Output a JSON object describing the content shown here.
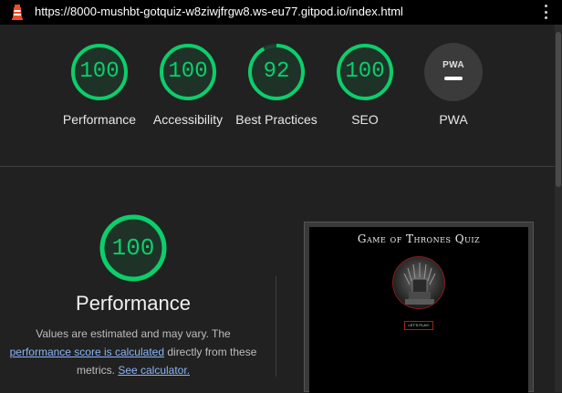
{
  "browser": {
    "url": "https://8000-mushbt-gotquiz-w8ziwjfrgw8.ws-eu77.gitpod.io/index.html"
  },
  "summary_gauges": [
    {
      "score": "100",
      "label": "Performance",
      "fraction": 1.0,
      "color": "#0cce6b"
    },
    {
      "score": "100",
      "label": "Accessibility",
      "fraction": 1.0,
      "color": "#0cce6b"
    },
    {
      "score": "92",
      "label": "Best Practices",
      "fraction": 0.92,
      "color": "#0cce6b"
    },
    {
      "score": "100",
      "label": "SEO",
      "fraction": 1.0,
      "color": "#0cce6b"
    },
    {
      "badge": "PWA",
      "label": "PWA"
    }
  ],
  "performance": {
    "score": "100",
    "fraction": 1.0,
    "title": "Performance",
    "desc_part1": "Values are estimated and may vary. The ",
    "desc_link1": "performance score is calculated",
    "desc_part2": " directly from these metrics. ",
    "desc_link2": "See calculator."
  },
  "final_screenshot": {
    "title": "Game of Thrones Quiz",
    "button": "LET'S PLAY!"
  },
  "colors": {
    "pass": "#0cce6b",
    "background": "#212121",
    "link": "#8ab4f8"
  }
}
